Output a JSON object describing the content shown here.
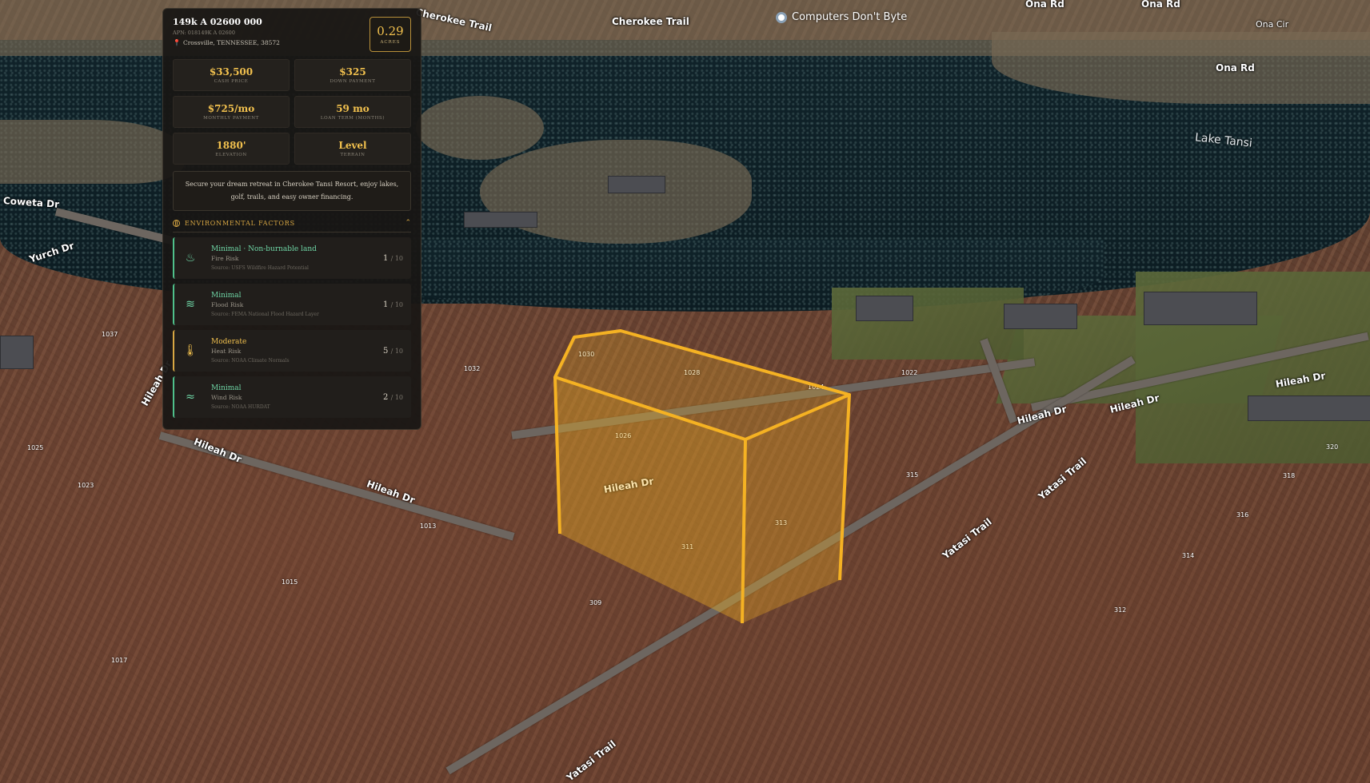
{
  "property": {
    "id": "149k A 02600 000",
    "apn": "APN: 018149K A 02600",
    "location": "Crossville, TENNESSEE, 38572",
    "acres_value": "0.29",
    "acres_label": "ACRES"
  },
  "stats": [
    {
      "value": "$33,500",
      "label": "CASH PRICE"
    },
    {
      "value": "$325",
      "label": "DOWN PAYMENT"
    },
    {
      "value": "$725/mo",
      "label": "MONTHLY PAYMENT"
    },
    {
      "value": "59 mo",
      "label": "LOAN TERM (MONTHS)"
    },
    {
      "value": "1880'",
      "label": "ELEVATION"
    },
    {
      "value": "Level",
      "label": "TERRAIN"
    }
  ],
  "description": "Secure your dream retreat in Cherokee Tansi Resort, enjoy lakes, golf, trails, and easy owner financing.",
  "environmental": {
    "title": "ENVIRONMENTAL FACTORS",
    "risks": [
      {
        "level": "Minimal · Non-burnable land",
        "name": "Fire Risk",
        "source": "Source: USFS Wildfire Hazard Potential",
        "score": "1",
        "out_of": "/ 10",
        "icon": "flame-icon"
      },
      {
        "level": "Minimal",
        "name": "Flood Risk",
        "source": "Source: FEMA National Flood Hazard Layer",
        "score": "1",
        "out_of": "/ 10",
        "icon": "waves-icon"
      },
      {
        "level": "Moderate",
        "name": "Heat Risk",
        "source": "Source: NOAA Climate Normals",
        "score": "5",
        "out_of": "/ 10",
        "icon": "thermometer-icon"
      },
      {
        "level": "Minimal",
        "name": "Wind Risk",
        "source": "Source: NOAA HURDAT",
        "score": "2",
        "out_of": "/ 10",
        "icon": "wind-icon"
      }
    ]
  },
  "map": {
    "roads": [
      {
        "name": "Cherokee Trail"
      },
      {
        "name": "Cherokee Trail"
      },
      {
        "name": "Ona Rd"
      },
      {
        "name": "Ona Rd"
      },
      {
        "name": "Ona Cir"
      },
      {
        "name": "Ona Rd"
      },
      {
        "name": "Coweta Dr"
      },
      {
        "name": "Yurch Dr"
      },
      {
        "name": "Hileah Dr"
      },
      {
        "name": "Hileah Dr"
      },
      {
        "name": "Hileah Dr"
      },
      {
        "name": "Hileah Dr"
      },
      {
        "name": "Hileah Dr"
      },
      {
        "name": "Hileah Dr"
      },
      {
        "name": "Hileah Dr"
      },
      {
        "name": "Yatasi Trail"
      },
      {
        "name": "Yatasi Trail"
      },
      {
        "name": "Yatasi Trail"
      }
    ],
    "lake_name": "Lake Tansi",
    "poi_name": "Computers Don't Byte",
    "addresses": [
      "1037",
      "1030",
      "1032",
      "1028",
      "1024",
      "1022",
      "1026",
      "1025",
      "1023",
      "1013",
      "1015",
      "1017",
      "309",
      "311",
      "313",
      "315",
      "316",
      "318",
      "320",
      "312",
      "314"
    ],
    "accent": "#f5b223"
  }
}
